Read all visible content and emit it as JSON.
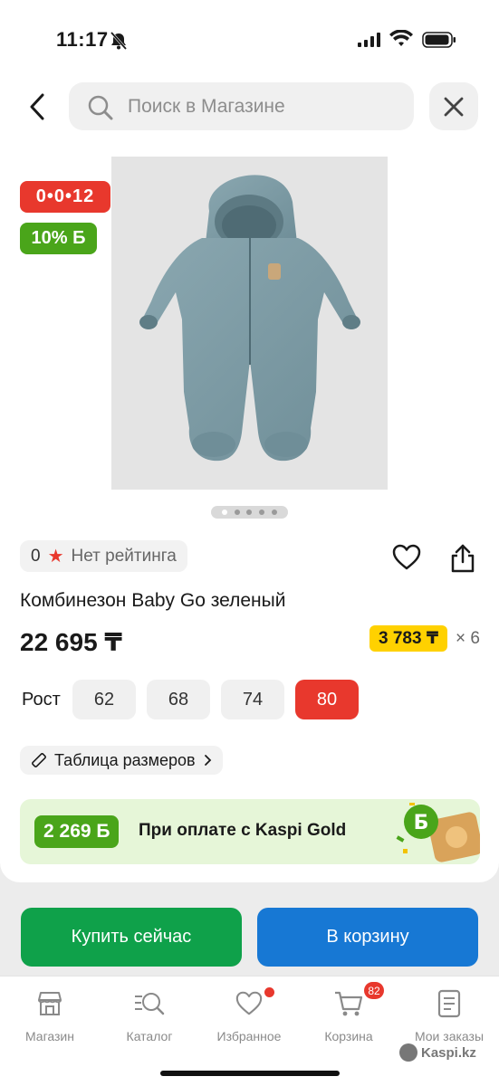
{
  "status_bar": {
    "time": "11:17"
  },
  "header": {
    "search_placeholder": "Поиск в Магазине"
  },
  "badges": {
    "timer": "0•0•12",
    "bonus": "10% Б"
  },
  "rating": {
    "value": "0",
    "label": "Нет рейтинга"
  },
  "product": {
    "title": "Комбинезон Baby Go зеленый",
    "price": "22 695 ₸",
    "installment_price": "3 783 ₸",
    "installment_months": "× 6",
    "image_dots": 5,
    "image_active_index": 0
  },
  "sizes": {
    "label": "Рост",
    "options": [
      "62",
      "68",
      "74",
      "80"
    ],
    "selected": "80",
    "table_link": "Таблица размеров"
  },
  "promo": {
    "amount": "2 269 Б",
    "text": "При оплате с Kaspi Gold"
  },
  "actions": {
    "buy_now": "Купить сейчас",
    "add_to_cart": "В корзину"
  },
  "tabbar": {
    "items": [
      {
        "label": "Магазин",
        "icon": "store-icon"
      },
      {
        "label": "Каталог",
        "icon": "catalog-search-icon"
      },
      {
        "label": "Избранное",
        "icon": "heart-icon"
      },
      {
        "label": "Корзина",
        "icon": "cart-icon"
      },
      {
        "label": "Мои заказы",
        "icon": "orders-icon"
      }
    ],
    "cart_count": "82"
  },
  "watermark": "Kaspi.kz",
  "colors": {
    "red": "#e8382d",
    "green": "#4aa51a",
    "buy": "#0fa14a",
    "cart": "#1778d4",
    "yellow": "#ffd100"
  }
}
